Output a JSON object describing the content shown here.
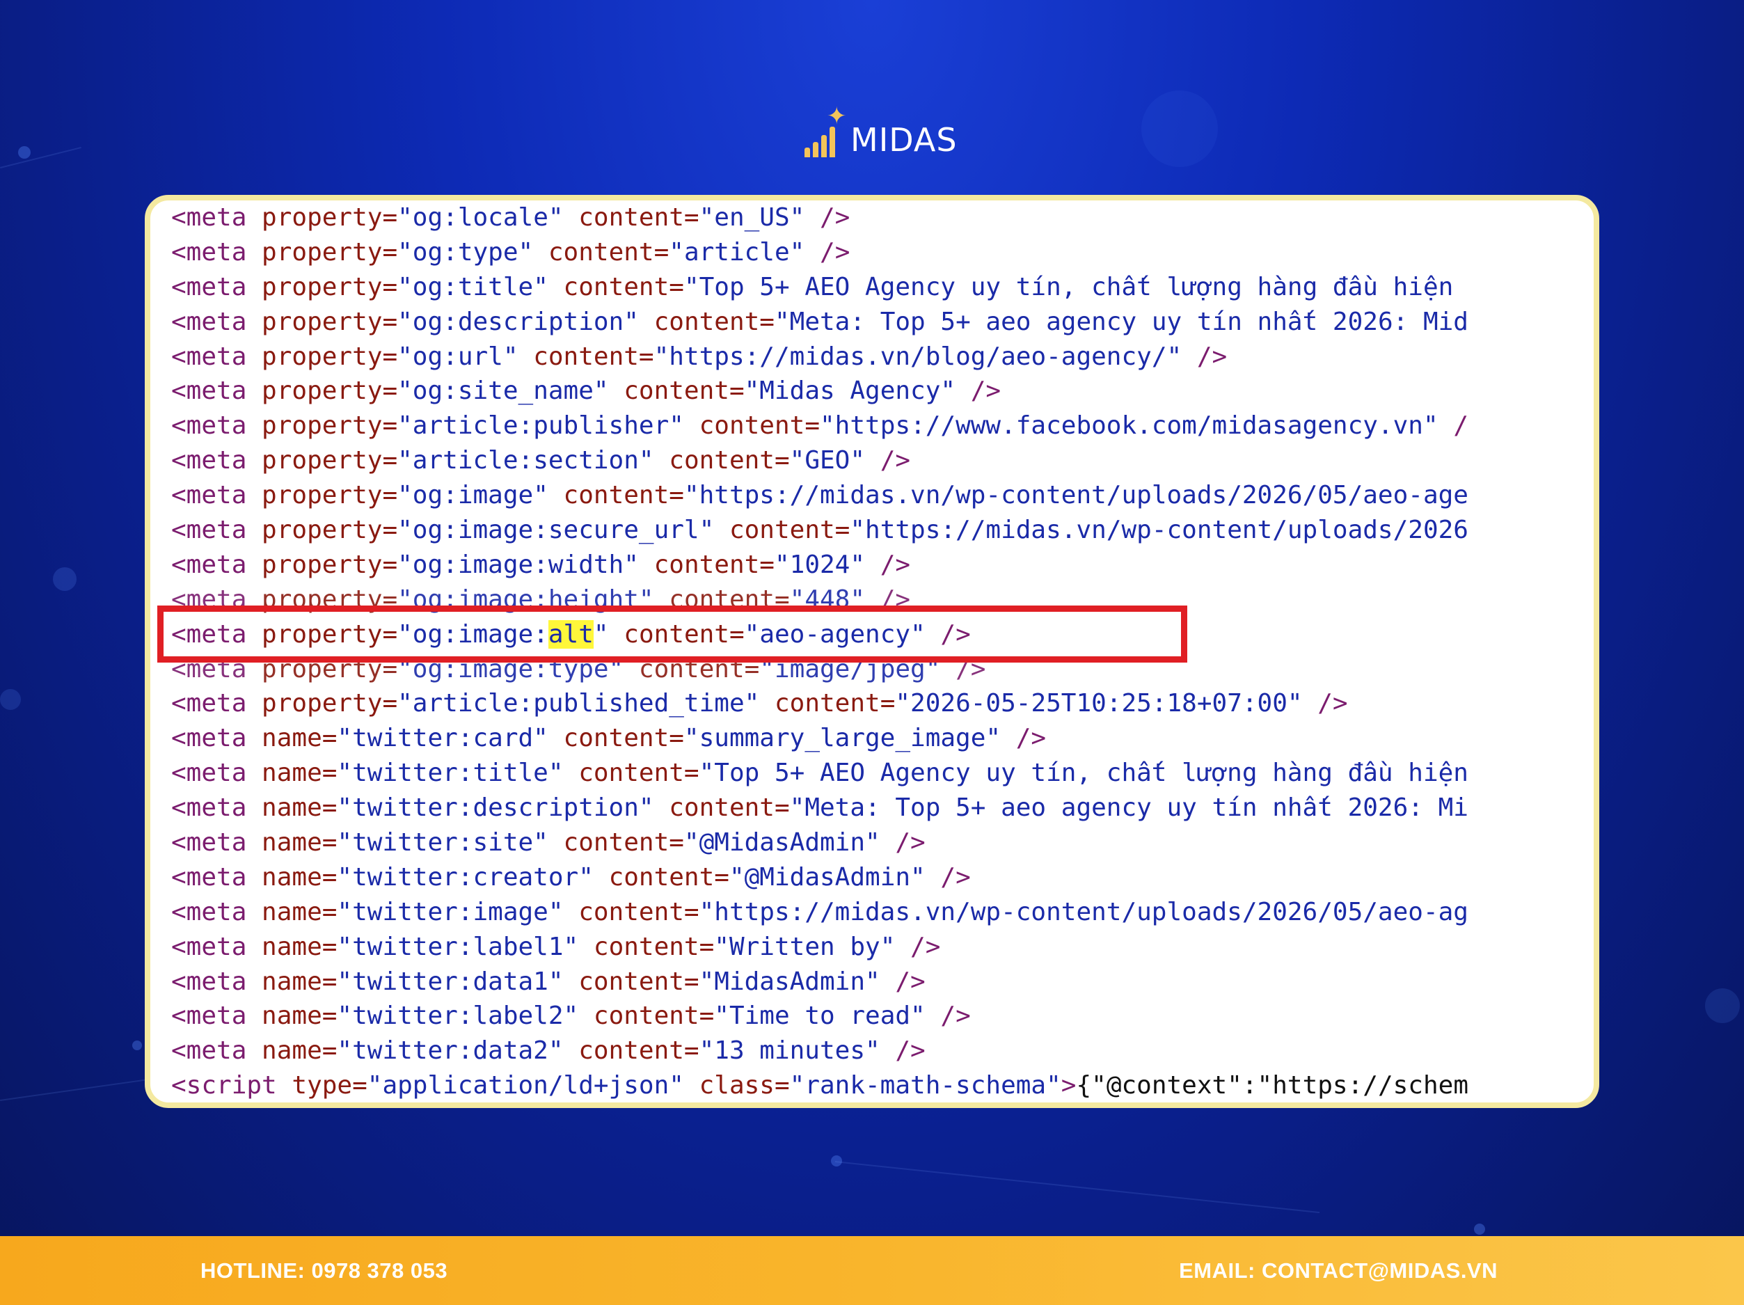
{
  "brand": {
    "name": "MIDAS"
  },
  "colors": {
    "highlight_box": "#e01f24",
    "text_highlight": "#fff73a",
    "footer": "#f9b52c",
    "card_border": "#f4e9a0"
  },
  "code_lines": [
    [
      [
        "tag",
        "<meta "
      ],
      [
        "attr",
        "property="
      ],
      [
        "val",
        "\"og:locale\" "
      ],
      [
        "attr",
        "content="
      ],
      [
        "val",
        "\"en_US\" "
      ],
      [
        "tag",
        "/>"
      ]
    ],
    [
      [
        "tag",
        "<meta "
      ],
      [
        "attr",
        "property="
      ],
      [
        "val",
        "\"og:type\" "
      ],
      [
        "attr",
        "content="
      ],
      [
        "val",
        "\"article\" "
      ],
      [
        "tag",
        "/>"
      ]
    ],
    [
      [
        "tag",
        "<meta "
      ],
      [
        "attr",
        "property="
      ],
      [
        "val",
        "\"og:title\" "
      ],
      [
        "attr",
        "content="
      ],
      [
        "val",
        "\"Top 5+ AEO Agency uy tín, chất lượng hàng đầu hiện"
      ]
    ],
    [
      [
        "tag",
        "<meta "
      ],
      [
        "attr",
        "property="
      ],
      [
        "val",
        "\"og:description\" "
      ],
      [
        "attr",
        "content="
      ],
      [
        "val",
        "\"Meta: Top 5+ aeo agency uy tín nhất 2026: Mid"
      ]
    ],
    [
      [
        "tag",
        "<meta "
      ],
      [
        "attr",
        "property="
      ],
      [
        "val",
        "\"og:url\" "
      ],
      [
        "attr",
        "content="
      ],
      [
        "val",
        "\"https://midas.vn/blog/aeo-agency/\" "
      ],
      [
        "tag",
        "/>"
      ]
    ],
    [
      [
        "tag",
        "<meta "
      ],
      [
        "attr",
        "property="
      ],
      [
        "val",
        "\"og:site_name\" "
      ],
      [
        "attr",
        "content="
      ],
      [
        "val",
        "\"Midas Agency\" "
      ],
      [
        "tag",
        "/>"
      ]
    ],
    [
      [
        "tag",
        "<meta "
      ],
      [
        "attr",
        "property="
      ],
      [
        "val",
        "\"article:publisher\" "
      ],
      [
        "attr",
        "content="
      ],
      [
        "val",
        "\"https://www.facebook.com/midasagency.vn\" "
      ],
      [
        "tag",
        "/"
      ]
    ],
    [
      [
        "tag",
        "<meta "
      ],
      [
        "attr",
        "property="
      ],
      [
        "val",
        "\"article:section\" "
      ],
      [
        "attr",
        "content="
      ],
      [
        "val",
        "\"GEO\" "
      ],
      [
        "tag",
        "/>"
      ]
    ],
    [
      [
        "tag",
        "<meta "
      ],
      [
        "attr",
        "property="
      ],
      [
        "val",
        "\"og:image\" "
      ],
      [
        "attr",
        "content="
      ],
      [
        "val",
        "\"https://midas.vn/wp-content/uploads/2026/05/aeo-age"
      ]
    ],
    [
      [
        "tag",
        "<meta "
      ],
      [
        "attr",
        "property="
      ],
      [
        "val",
        "\"og:image:secure_url\" "
      ],
      [
        "attr",
        "content="
      ],
      [
        "val",
        "\"https://midas.vn/wp-content/uploads/2026"
      ]
    ],
    [
      [
        "tag",
        "<meta "
      ],
      [
        "attr",
        "property="
      ],
      [
        "val",
        "\"og:image:width\" "
      ],
      [
        "attr",
        "content="
      ],
      [
        "val",
        "\"1024\" "
      ],
      [
        "tag",
        "/>"
      ]
    ],
    [
      [
        "tag",
        "<meta "
      ],
      [
        "attr",
        "property="
      ],
      [
        "val",
        "\"og:image:height\" "
      ],
      [
        "attr",
        "content="
      ],
      [
        "val",
        "\"448\" "
      ],
      [
        "tag",
        "/>"
      ]
    ],
    [
      [
        "tag",
        "<meta "
      ],
      [
        "attr",
        "property="
      ],
      [
        "val",
        "\"og:image:"
      ],
      [
        "hl",
        "alt"
      ],
      [
        "val",
        "\" "
      ],
      [
        "attr",
        "content="
      ],
      [
        "val",
        "\"aeo-agency\" "
      ],
      [
        "tag",
        "/>"
      ]
    ],
    [
      [
        "tag",
        "<meta "
      ],
      [
        "attr",
        "property="
      ],
      [
        "val",
        "\"og:image:type\" "
      ],
      [
        "attr",
        "content="
      ],
      [
        "val",
        "\"image/jpeg\" "
      ],
      [
        "tag",
        "/>"
      ]
    ],
    [
      [
        "tag",
        "<meta "
      ],
      [
        "attr",
        "property="
      ],
      [
        "val",
        "\"article:published_time\" "
      ],
      [
        "attr",
        "content="
      ],
      [
        "val",
        "\"2026-05-25T10:25:18+07:00\" "
      ],
      [
        "tag",
        "/>"
      ]
    ],
    [
      [
        "tag",
        "<meta "
      ],
      [
        "attr",
        "name="
      ],
      [
        "val",
        "\"twitter:card\" "
      ],
      [
        "attr",
        "content="
      ],
      [
        "val",
        "\"summary_large_image\" "
      ],
      [
        "tag",
        "/>"
      ]
    ],
    [
      [
        "tag",
        "<meta "
      ],
      [
        "attr",
        "name="
      ],
      [
        "val",
        "\"twitter:title\" "
      ],
      [
        "attr",
        "content="
      ],
      [
        "val",
        "\"Top 5+ AEO Agency uy tín, chất lượng hàng đầu hiện"
      ]
    ],
    [
      [
        "tag",
        "<meta "
      ],
      [
        "attr",
        "name="
      ],
      [
        "val",
        "\"twitter:description\" "
      ],
      [
        "attr",
        "content="
      ],
      [
        "val",
        "\"Meta: Top 5+ aeo agency uy tín nhất 2026: Mi"
      ]
    ],
    [
      [
        "tag",
        "<meta "
      ],
      [
        "attr",
        "name="
      ],
      [
        "val",
        "\"twitter:site\" "
      ],
      [
        "attr",
        "content="
      ],
      [
        "val",
        "\"@MidasAdmin\" "
      ],
      [
        "tag",
        "/>"
      ]
    ],
    [
      [
        "tag",
        "<meta "
      ],
      [
        "attr",
        "name="
      ],
      [
        "val",
        "\"twitter:creator\" "
      ],
      [
        "attr",
        "content="
      ],
      [
        "val",
        "\"@MidasAdmin\" "
      ],
      [
        "tag",
        "/>"
      ]
    ],
    [
      [
        "tag",
        "<meta "
      ],
      [
        "attr",
        "name="
      ],
      [
        "val",
        "\"twitter:image\" "
      ],
      [
        "attr",
        "content="
      ],
      [
        "val",
        "\"https://midas.vn/wp-content/uploads/2026/05/aeo-ag"
      ]
    ],
    [
      [
        "tag",
        "<meta "
      ],
      [
        "attr",
        "name="
      ],
      [
        "val",
        "\"twitter:label1\" "
      ],
      [
        "attr",
        "content="
      ],
      [
        "val",
        "\"Written by\" "
      ],
      [
        "tag",
        "/>"
      ]
    ],
    [
      [
        "tag",
        "<meta "
      ],
      [
        "attr",
        "name="
      ],
      [
        "val",
        "\"twitter:data1\" "
      ],
      [
        "attr",
        "content="
      ],
      [
        "val",
        "\"MidasAdmin\" "
      ],
      [
        "tag",
        "/>"
      ]
    ],
    [
      [
        "tag",
        "<meta "
      ],
      [
        "attr",
        "name="
      ],
      [
        "val",
        "\"twitter:label2\" "
      ],
      [
        "attr",
        "content="
      ],
      [
        "val",
        "\"Time to read\" "
      ],
      [
        "tag",
        "/>"
      ]
    ],
    [
      [
        "tag",
        "<meta "
      ],
      [
        "attr",
        "name="
      ],
      [
        "val",
        "\"twitter:data2\" "
      ],
      [
        "attr",
        "content="
      ],
      [
        "val",
        "\"13 minutes\" "
      ],
      [
        "tag",
        "/>"
      ]
    ],
    [
      [
        "tag",
        "<script "
      ],
      [
        "attr",
        "type="
      ],
      [
        "val",
        "\"application/ld+json\" "
      ],
      [
        "attr",
        "class="
      ],
      [
        "val",
        "\"rank-math-schema\""
      ],
      [
        "tag",
        ">"
      ],
      [
        "plain",
        "{\"@context\":\"https://schem"
      ]
    ]
  ],
  "footer": {
    "hotline": "HOTLINE: 0978 378 053",
    "email": "EMAIL: CONTACT@MIDAS.VN"
  }
}
